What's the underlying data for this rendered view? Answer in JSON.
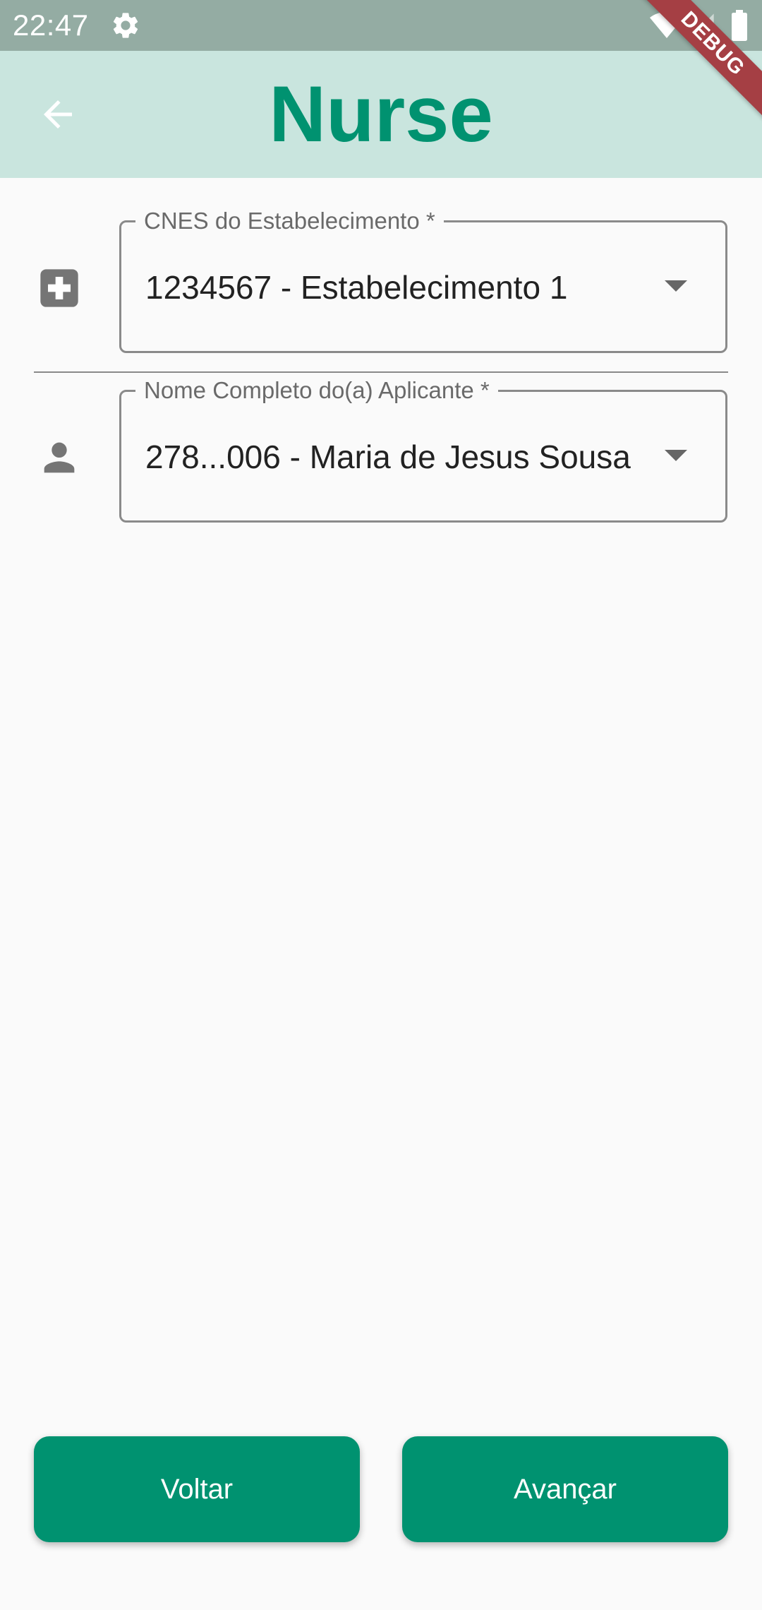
{
  "status_bar": {
    "time": "22:47",
    "icons": [
      "settings-icon",
      "wifi-icon",
      "signal-icon",
      "battery-icon"
    ]
  },
  "app_bar": {
    "title": "Nurse",
    "back_icon": "arrow-back-icon"
  },
  "debug_ribbon": "DEBUG",
  "form": {
    "establishment": {
      "label": "CNES do Estabelecimento *",
      "value": "1234567 - Estabelecimento 1",
      "icon": "medical-plus-icon"
    },
    "applicant": {
      "label": "Nome Completo do(a) Aplicante *",
      "value": "278...006 - Maria de Jesus Sousa",
      "icon": "person-icon"
    }
  },
  "buttons": {
    "back_label": "Voltar",
    "next_label": "Avançar"
  },
  "colors": {
    "primary": "#009270",
    "app_bar_bg": "#c9e5de",
    "status_bar_bg": "#94aca3",
    "debug_ribbon": "#a53f44",
    "page_bg": "#fafafa"
  }
}
